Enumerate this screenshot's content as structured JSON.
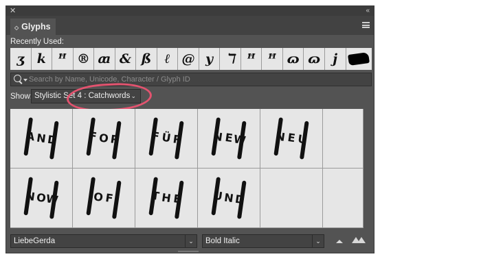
{
  "panel": {
    "tab_title": "Glyphs",
    "close_glyph": "✕",
    "collapse_glyph": "«",
    "tab_arrows": "◇"
  },
  "recent": {
    "label": "Recently Used:",
    "glyphs": [
      "ʒ",
      "k",
      "ꟸ",
      "®",
      "ꜳ",
      "&",
      "ß",
      "ℓ",
      "@",
      "y",
      "ℸ",
      "ꟸ",
      "ꟸ",
      "ɷ",
      "ɷ",
      "j",
      ""
    ]
  },
  "search": {
    "placeholder": "Search by Name, Unicode, Character / Glyph ID"
  },
  "show": {
    "label": "Show:",
    "value": "Stylistic Set 4 : Catchwords",
    "chevron": "⌄"
  },
  "catchwords": [
    {
      "letters": [
        "A",
        "N",
        "D"
      ]
    },
    {
      "letters": [
        "F",
        "O",
        "R"
      ]
    },
    {
      "letters": [
        "F",
        "Ü",
        "R"
      ]
    },
    {
      "letters": [
        "N",
        "E",
        "W"
      ]
    },
    {
      "letters": [
        "N",
        "E",
        "U"
      ]
    },
    {
      "letters": [
        "N",
        "O",
        "W"
      ]
    },
    {
      "letters": [
        "O",
        "F"
      ]
    },
    {
      "letters": [
        "T",
        "H",
        "E"
      ]
    },
    {
      "letters": [
        "U",
        "N",
        "D"
      ]
    }
  ],
  "footer": {
    "font_family": "LiebeGerda",
    "font_style": "Bold Italic",
    "dropdown_glyph": "⌄"
  },
  "colors": {
    "panel_bg": "#535353",
    "cell_bg": "#e6e6e6",
    "highlight": "#e3536f"
  }
}
